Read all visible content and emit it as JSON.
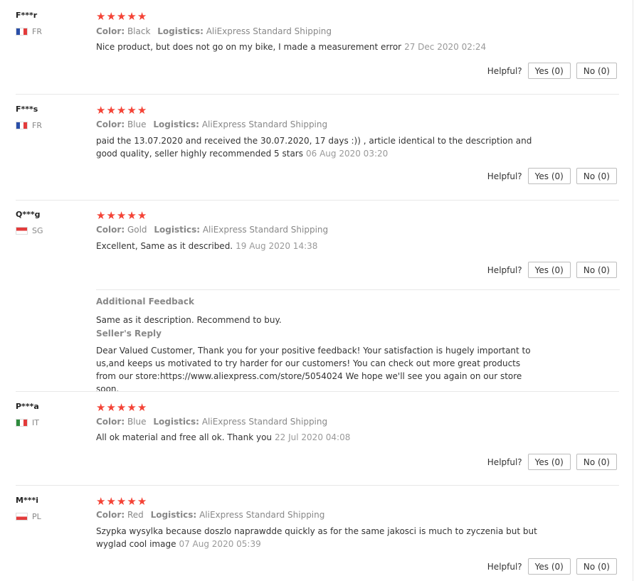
{
  "rating_star_glyph": "★",
  "accent_star_color": "#f44336",
  "helpful_label": "Helpful?",
  "labels": {
    "color": "Color:",
    "logistics": "Logistics:"
  },
  "reviews": [
    {
      "user": "F***r",
      "country": "FR",
      "flag": "flag-fr-icon",
      "stars": 5,
      "color": "Black",
      "logistics": "AliExpress Standard Shipping",
      "text": "Nice product, but does not go on my bike, I made a measurement error",
      "date": "27 Dec 2020 02:24",
      "yes_label": "Yes (0)",
      "no_label": "No (0)"
    },
    {
      "user": "F***s",
      "country": "FR",
      "flag": "flag-fr-icon",
      "stars": 5,
      "color": "Blue",
      "logistics": "AliExpress Standard Shipping",
      "text": "paid the 13.07.2020 and received the 30.07.2020, 17 days :)) , article identical to the description and good quality, seller highly recommended 5 stars",
      "date": "06 Aug 2020 03:20",
      "yes_label": "Yes (0)",
      "no_label": "No (0)"
    },
    {
      "user": "Q***g",
      "country": "SG",
      "flag": "flag-sg-icon",
      "stars": 5,
      "color": "Gold",
      "logistics": "AliExpress Standard Shipping",
      "text": "Excellent, Same as it described.",
      "date": "19 Aug 2020 14:38",
      "yes_label": "Yes (0)",
      "no_label": "No (0)",
      "additional_feedback_title": "Additional Feedback",
      "additional_feedback": "Same as it description. Recommend to buy.",
      "seller_reply_title": "Seller's Reply",
      "seller_reply": "Dear Valued Customer, Thank you for your positive feedback! Your satisfaction is hugely important to us,and keeps us motivated to try harder for our customers! You can check out more great products from our store:https://www.aliexpress.com/store/5054024 We hope we'll see you again on our store soon."
    },
    {
      "user": "P***a",
      "country": "IT",
      "flag": "flag-it-icon",
      "stars": 5,
      "color": "Blue",
      "logistics": "AliExpress Standard Shipping",
      "text": "All ok material and free all ok. Thank you",
      "date": "22 Jul 2020 04:08",
      "yes_label": "Yes (0)",
      "no_label": "No (0)"
    },
    {
      "user": "M***i",
      "country": "PL",
      "flag": "flag-pl-icon",
      "stars": 5,
      "color": "Red",
      "logistics": "AliExpress Standard Shipping",
      "text": "Szypka wysylka because doszlo naprawdde quickly as for the same jakosci is much to zyczenia but but wyglad cool image",
      "date": "07 Aug 2020 05:39",
      "yes_label": "Yes (0)",
      "no_label": "No (0)"
    }
  ]
}
